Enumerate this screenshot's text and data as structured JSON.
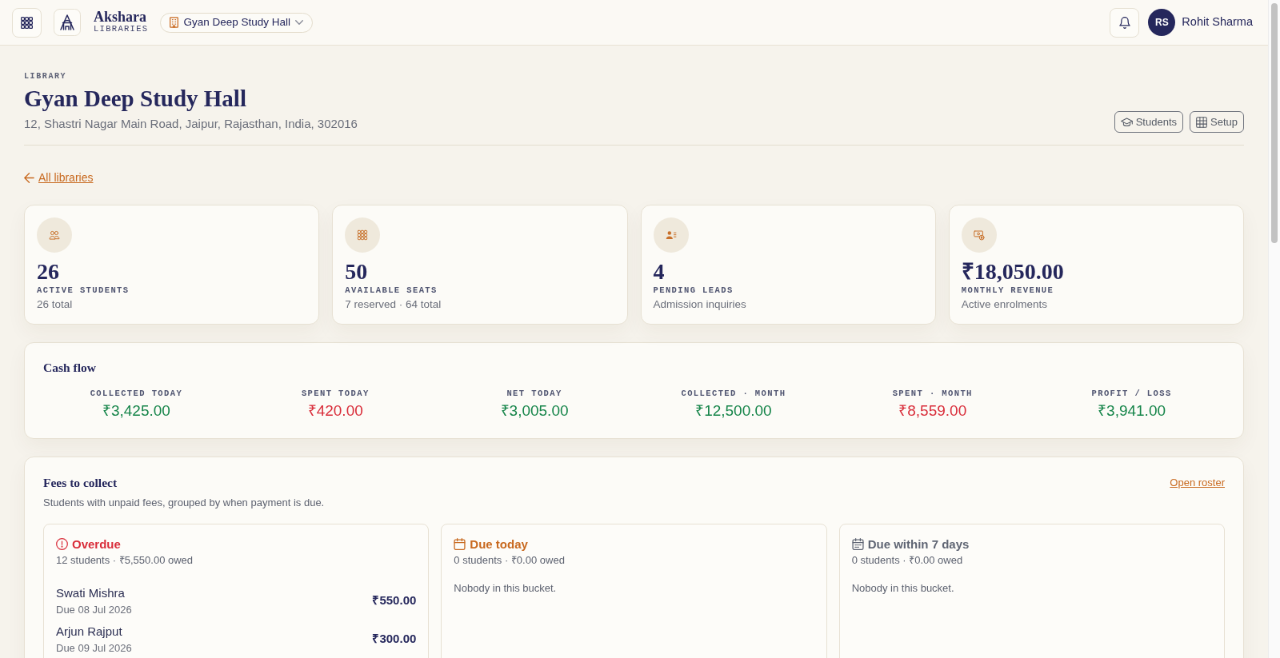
{
  "topbar": {
    "brand": {
      "name": "Akshara",
      "tagline": "LIBRARIES"
    },
    "library_selector": {
      "label": "Gyan Deep Study Hall"
    },
    "user": {
      "initials": "RS",
      "name": "Rohit Sharma"
    }
  },
  "header": {
    "eyebrow": "LIBRARY",
    "title": "Gyan Deep Study Hall",
    "address": "12, Shastri Nagar Main Road, Jaipur, Rajasthan, India, 302016",
    "buttons": [
      "Students",
      "Setup"
    ]
  },
  "back_link": "All libraries",
  "stats": [
    {
      "value": "26",
      "label": "ACTIVE STUDENTS",
      "note": "26 total"
    },
    {
      "value": "50",
      "label": "AVAILABLE SEATS",
      "note": "7 reserved · 64 total"
    },
    {
      "value": "4",
      "label": "PENDING LEADS",
      "note": "Admission inquiries"
    },
    {
      "value": "₹18,050.00",
      "label": "MONTHLY REVENUE",
      "note": "Active enrolments"
    }
  ],
  "cash_flow": {
    "title": "Cash flow",
    "items": [
      {
        "label": "COLLECTED TODAY",
        "value": "₹3,425.00",
        "kind": "gain"
      },
      {
        "label": "SPENT TODAY",
        "value": "₹420.00",
        "kind": "loss"
      },
      {
        "label": "NET TODAY",
        "value": "₹3,005.00",
        "kind": "gain"
      },
      {
        "label": "COLLECTED · MONTH",
        "value": "₹12,500.00",
        "kind": "gain"
      },
      {
        "label": "SPENT · MONTH",
        "value": "₹8,559.00",
        "kind": "loss"
      },
      {
        "label": "PROFIT / LOSS",
        "value": "₹3,941.00",
        "kind": "gain"
      }
    ]
  },
  "fees": {
    "title": "Fees to collect",
    "subtitle": "Students with unpaid fees, grouped by when payment is due.",
    "link": "Open roster",
    "buckets": [
      {
        "kind": "overdue",
        "title": "Overdue",
        "summary": "12 students · ₹5,550.00 owed",
        "students": [
          {
            "name": "Swati Mishra",
            "due": "Due 08 Jul 2026",
            "amount": "₹550.00"
          },
          {
            "name": "Arjun Rajput",
            "due": "Due 09 Jul 2026",
            "amount": "₹300.00"
          }
        ]
      },
      {
        "kind": "today",
        "title": "Due today",
        "summary": "0 students · ₹0.00 owed",
        "empty_note": "Nobody in this bucket."
      },
      {
        "kind": "upcoming",
        "title": "Due within 7 days",
        "summary": "0 students · ₹0.00 owed",
        "empty_note": "Nobody in this bucket."
      }
    ]
  }
}
